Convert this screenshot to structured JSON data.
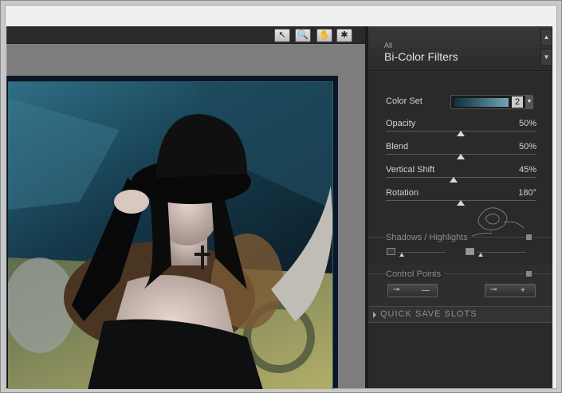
{
  "panel": {
    "header_small": "All",
    "header_title": "Bi-Color Filters",
    "scroll_up": "▲",
    "scroll_down": "▼"
  },
  "filters": {
    "color_set_label": "Color Set",
    "color_set_value": "2",
    "color_set_gradient": [
      "#0f2f3c",
      "#6fa6b8"
    ],
    "opacity_label": "Opacity",
    "opacity_value": "50%",
    "opacity_level": 0.5,
    "blend_label": "Blend",
    "blend_value": "50%",
    "blend_level": 0.5,
    "vshift_label": "Vertical Shift",
    "vshift_value": "45%",
    "vshift_level": 0.45,
    "rotation_label": "Rotation",
    "rotation_value": "180°",
    "rotation_level": 0.5
  },
  "sections": {
    "shadows_label": "Shadows / Highlights",
    "control_points_label": "Control Points",
    "quick_save_label": "QUICK SAVE SLOTS"
  },
  "toolbar": {
    "tools": [
      {
        "name": "pointer-tool",
        "glyph": "↖"
      },
      {
        "name": "zoom-tool",
        "glyph": "🔍"
      },
      {
        "name": "hand-tool",
        "glyph": "✋"
      },
      {
        "name": "light-tool",
        "glyph": "✱"
      }
    ]
  },
  "control_points": {
    "remove_glyph": "—",
    "add_glyph": "+"
  },
  "colors": {
    "panel_bg": "#2e2e2e",
    "canvas_bg": "#7d7d7d"
  }
}
